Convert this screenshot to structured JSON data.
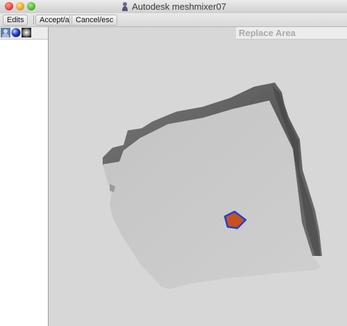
{
  "window": {
    "title": "Autodesk meshmixer07"
  },
  "menubar": {
    "items": [
      {
        "label": "Edits"
      },
      {
        "label": "Accept/a"
      },
      {
        "label": "Cancel/esc"
      }
    ]
  },
  "left_panel": {
    "buttons": [
      {
        "icon": "bust-figure-icon"
      },
      {
        "icon": "sphere-icon"
      },
      {
        "icon": "shading-square-icon"
      }
    ]
  },
  "viewport": {
    "tool_title": "Replace Area",
    "mesh_color": "#c8c8c8",
    "selection_fill": "#c8521f",
    "selection_outline": "#1f3fd6"
  }
}
